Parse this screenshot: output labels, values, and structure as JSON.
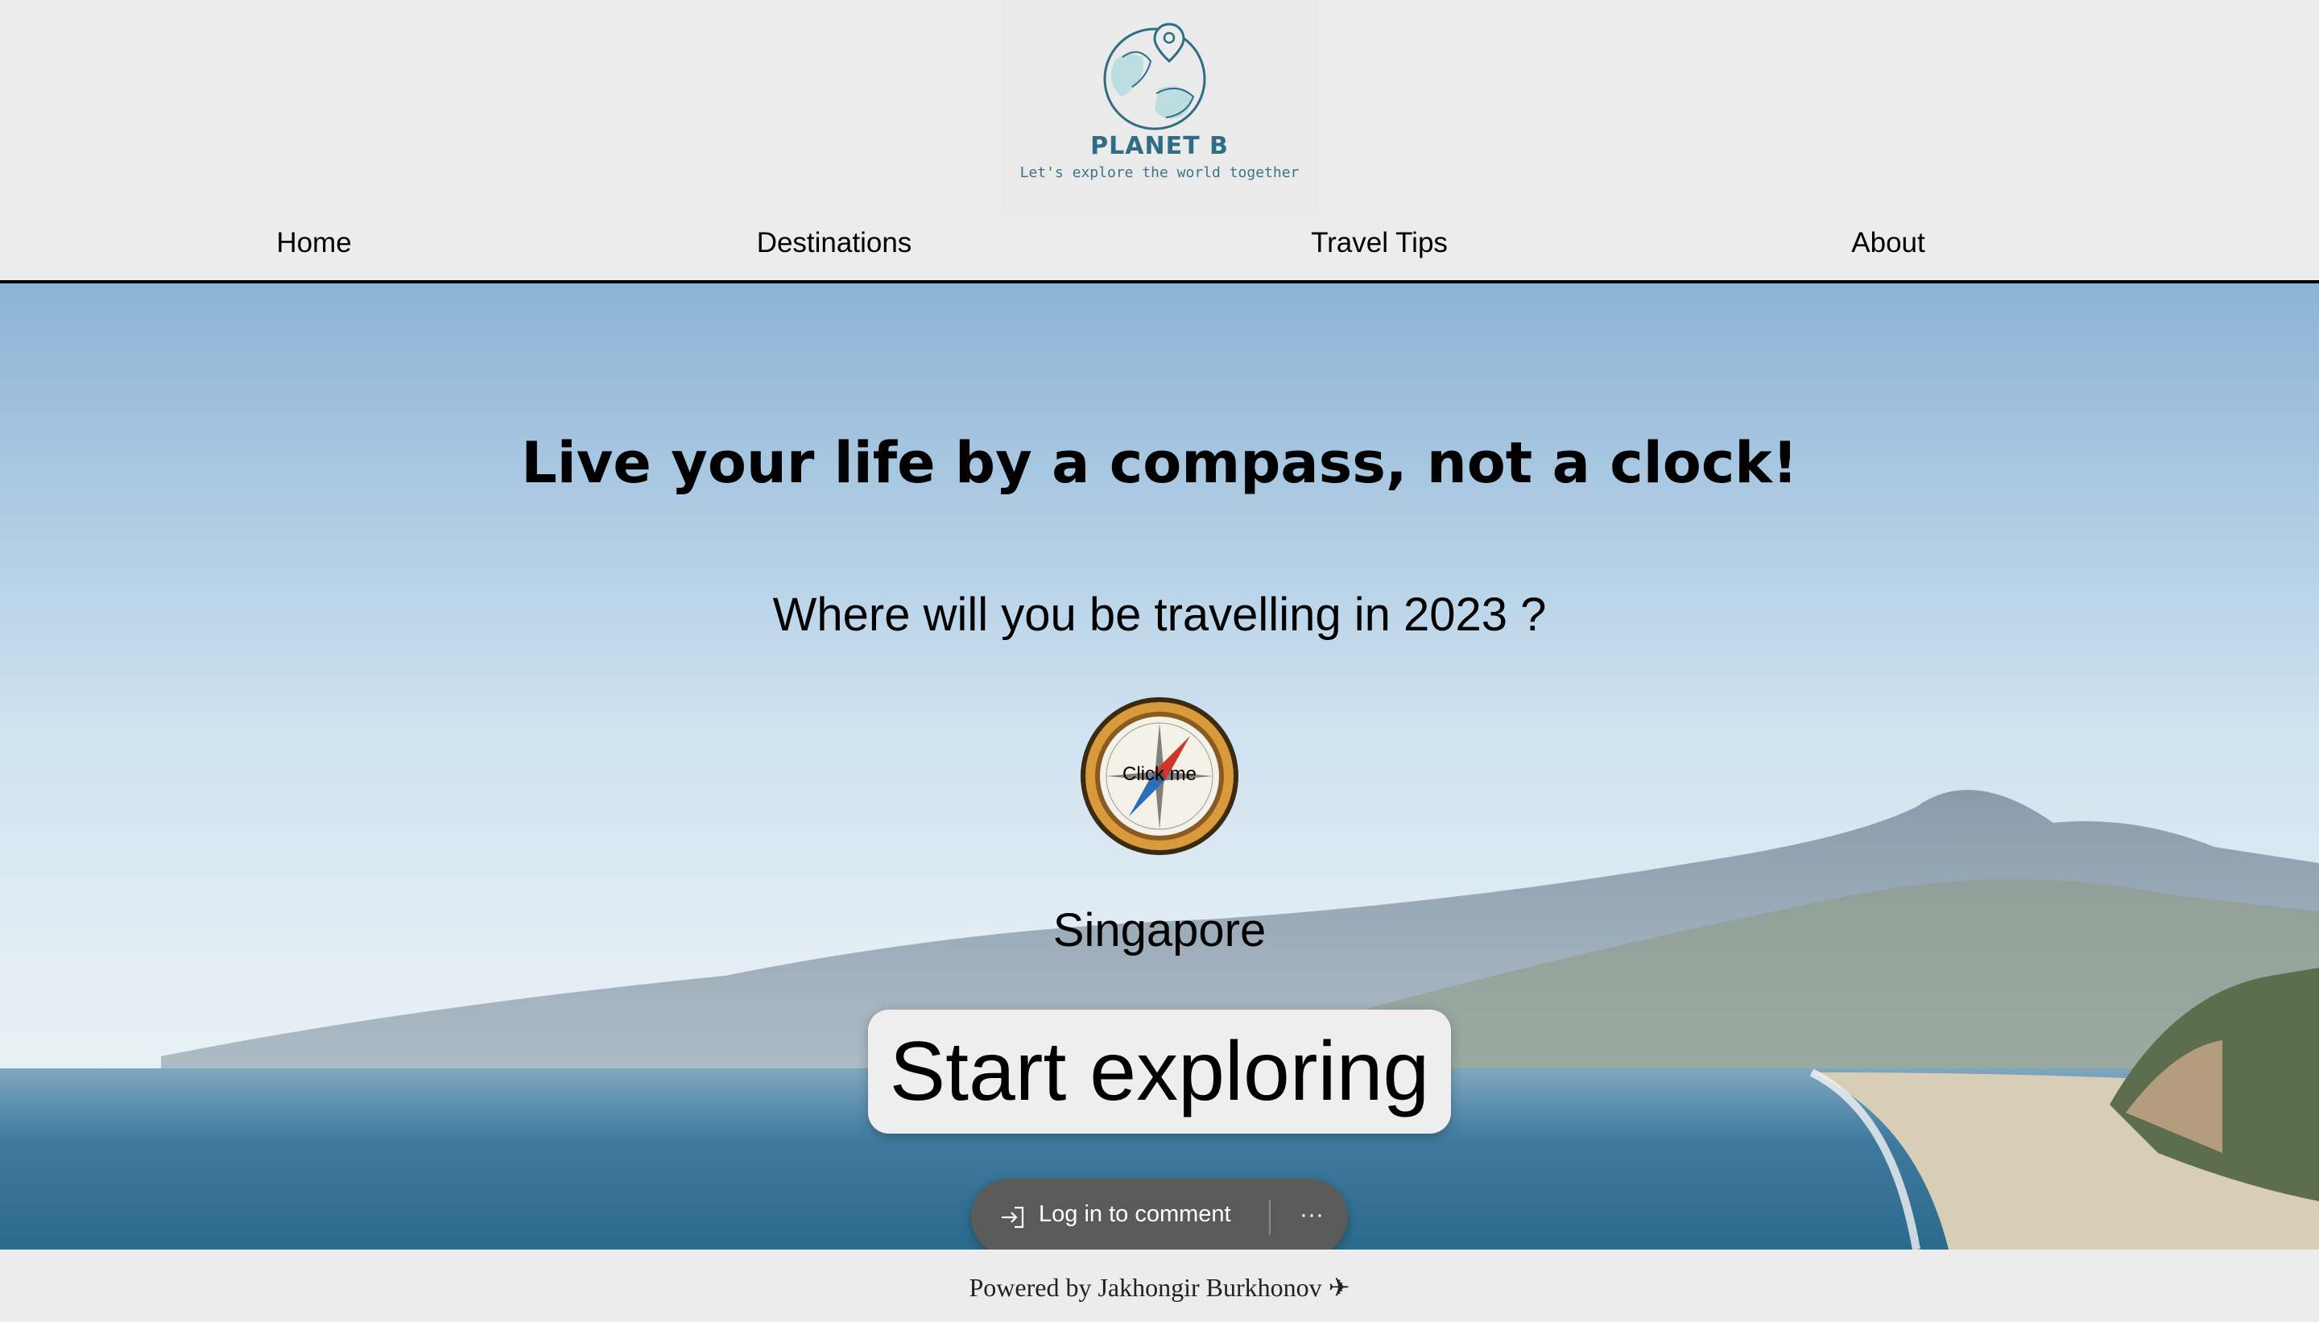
{
  "brand": {
    "name": "PLANET B",
    "tagline": "Let's explore the world together"
  },
  "nav": {
    "items": [
      {
        "label": "Home"
      },
      {
        "label": "Destinations"
      },
      {
        "label": "Travel Tips"
      },
      {
        "label": "About"
      }
    ]
  },
  "hero": {
    "headline": "Live your life by a compass, not a clock!",
    "question": "Where will you be travelling in 2023 ?",
    "compass_label": "Click me",
    "destination": "Singapore",
    "cta_label": "Start exploring"
  },
  "comment_bar": {
    "login_label": "Log in to comment",
    "more_label": "···"
  },
  "footer": {
    "text": "Powered by Jakhongir Burkhonov ✈"
  },
  "colors": {
    "brand": "#2f6d85",
    "header_bg": "#ececec",
    "pill_bg": "#5a5a5a"
  }
}
